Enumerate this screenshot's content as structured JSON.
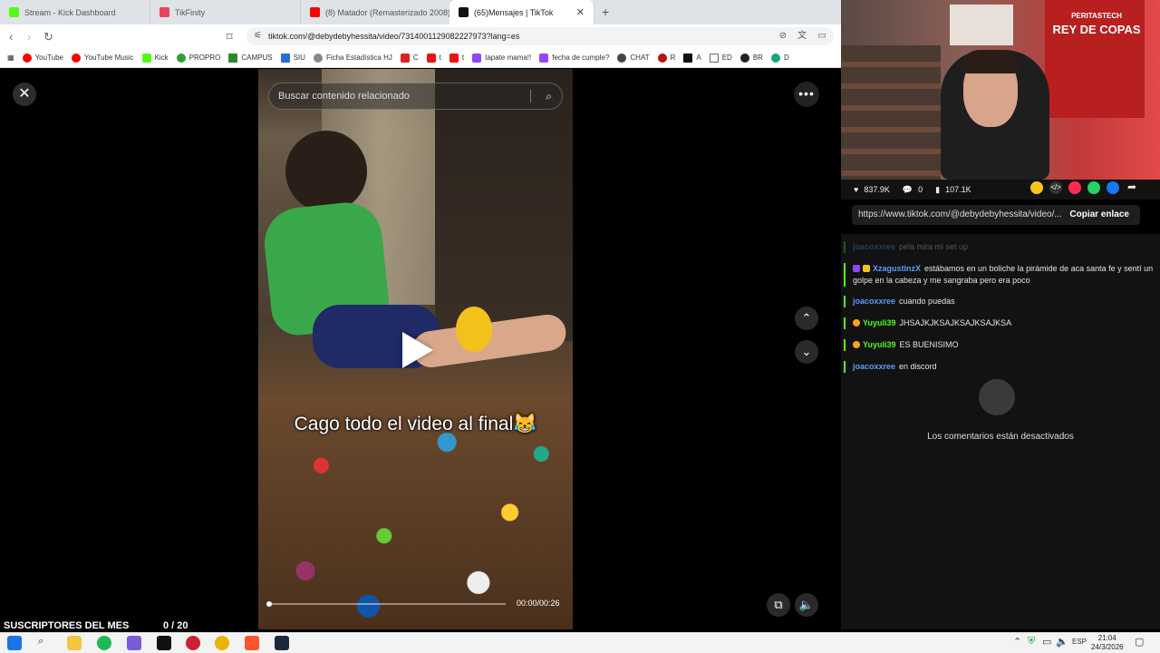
{
  "browser": {
    "tabs": [
      {
        "title": "Stream - Kick Dashboard",
        "color": "#53fc18"
      },
      {
        "title": "TikFinity",
        "color": "#e8455a"
      },
      {
        "title": "(8) Matador (Remasterizado 2008) - Y",
        "color": "#ff0000"
      },
      {
        "title": "(65)Mensajes | TikTok",
        "color": "#111111"
      }
    ],
    "url": "tiktok.com/@debydebyhessita/video/7314001129082227973?lang=es",
    "bookmarks": [
      "YouTube",
      "YouTube Music",
      "Kick",
      "PROPRO",
      "CAMPUS",
      "SIU",
      "Ficha Estadística HJ",
      "C",
      "t",
      "t",
      "tapate mama!!",
      "fecha de cumple?",
      "CHAT",
      "R",
      "A",
      "ED",
      "BR",
      "D"
    ]
  },
  "viewer": {
    "search_placeholder": "Buscar contenido relacionado",
    "caption": "Cago todo el video al final😹",
    "timecode": "00:00/00:26",
    "progress": 0
  },
  "stream_panel": {
    "likes": "837.9K",
    "comments": "0",
    "saves": "107.1K",
    "link": "https://www.tiktok.com/@debydebyhessita/video/...",
    "copy_label": "Copiar enlace",
    "poster_text": "REY DE COPAS",
    "poster_top": "PERITASTECH",
    "chat": [
      {
        "user": "joacoxxree",
        "text": "pela mira mi set up",
        "color": "#5b9bff",
        "faded": true
      },
      {
        "user": "XzagustinzX",
        "text": "estábamos en un boliche la pirámide de aca santa fe y sentí un golpe en la cabeza y me sangraba pero era poco",
        "color": "#5b9bff",
        "faded": false
      },
      {
        "user": "joacoxxree",
        "text": "cuando puedas",
        "color": "#5b9bff",
        "faded": false
      },
      {
        "user": "Yuyuli39",
        "text": "JHSAJKJKSAJKSAJKSAJKSA",
        "color": "#53fc18",
        "faded": false
      },
      {
        "user": "Yuyuli39",
        "text": "ES BUENISIMO",
        "color": "#53fc18",
        "faded": false
      },
      {
        "user": "joacoxxree",
        "text": "en discord",
        "color": "#5b9bff",
        "faded": false
      }
    ],
    "comments_disabled": "Los comentarios están desactivados"
  },
  "overlay": {
    "subs_label": "SUSCRIPTORES DEL MES",
    "subs_count": "0 / 20"
  },
  "taskbar": {
    "lang": "ESP",
    "time": "21:04",
    "date": "24/3/2026"
  }
}
